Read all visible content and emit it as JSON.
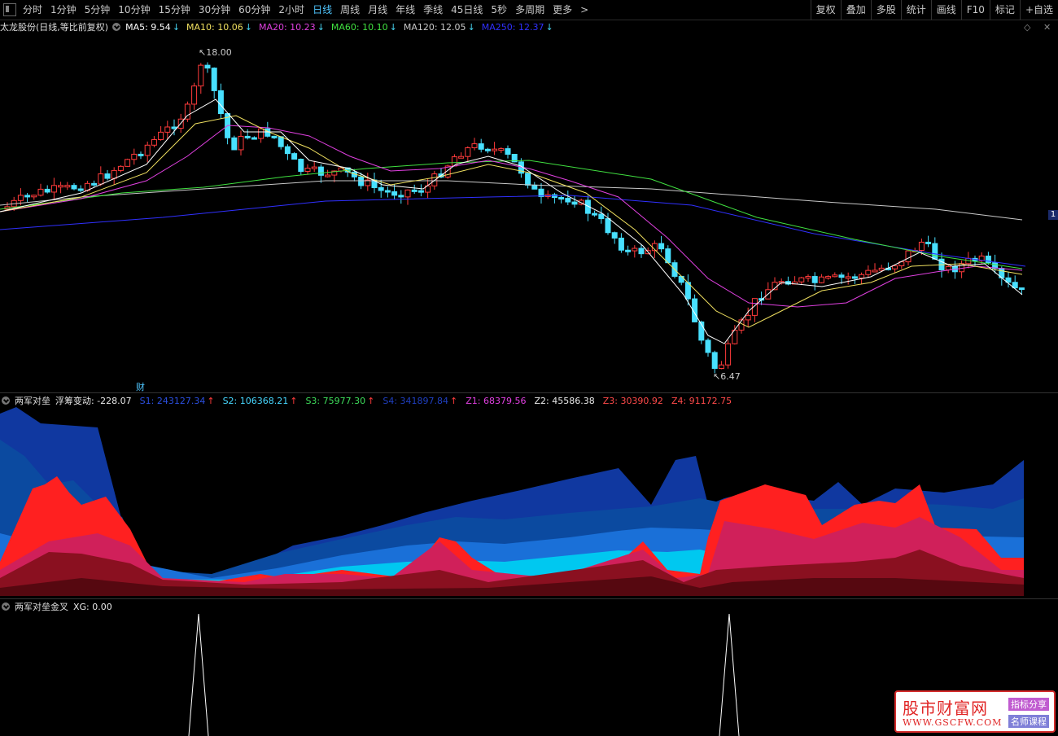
{
  "toolbar": {
    "periods": [
      "分时",
      "1分钟",
      "5分钟",
      "10分钟",
      "15分钟",
      "30分钟",
      "60分钟",
      "2小时",
      "日线",
      "周线",
      "月线",
      "年线",
      "季线",
      "45日线",
      "5秒",
      "多周期",
      "更多"
    ],
    "active_index": 8,
    "more_arrow": ">",
    "right": [
      "复权",
      "叠加",
      "多股",
      "统计",
      "画线",
      "F10",
      "标记",
      "+自选"
    ]
  },
  "main": {
    "title": "太龙股份(日线,等比前复权)",
    "mas": [
      {
        "label": "MA5: 9.54",
        "arrow": "↓",
        "color": "#ffffff"
      },
      {
        "label": "MA10: 10.06",
        "arrow": "↓",
        "color": "#f0e060"
      },
      {
        "label": "MA20: 10.23",
        "arrow": "↓",
        "color": "#e040e0"
      },
      {
        "label": "MA60: 10.10",
        "arrow": "↓",
        "color": "#40e040"
      },
      {
        "label": "MA120: 12.05",
        "arrow": "↓",
        "color": "#c8c8c8"
      },
      {
        "label": "MA250: 12.37",
        "arrow": "↓",
        "color": "#3030ff"
      }
    ],
    "high_label": "18.00",
    "low_label": "6.47",
    "cai": "财",
    "ctrl_icons": [
      "diamond-icon",
      "close-icon"
    ],
    "price_tag": "1"
  },
  "ind1": {
    "title": "两军对垒",
    "items": [
      {
        "label": "浮筹变动: -228.07",
        "color": "#e8e8e8",
        "arrow": ""
      },
      {
        "label": "S1: 243127.34",
        "color": "#2b4fe0",
        "arrow": "↑"
      },
      {
        "label": "S2: 106368.21",
        "color": "#47d7ff",
        "arrow": "↑"
      },
      {
        "label": "S3: 75977.30",
        "color": "#3ddc5a",
        "arrow": "↑"
      },
      {
        "label": "S4: 341897.84",
        "color": "#1f3fc0",
        "arrow": "↑"
      },
      {
        "label": "Z1: 68379.56",
        "color": "#e040e0",
        "arrow": ""
      },
      {
        "label": "Z2: 45586.38",
        "color": "#e8e8e8",
        "arrow": ""
      },
      {
        "label": "Z3: 30390.92",
        "color": "#ff4a4a",
        "arrow": ""
      },
      {
        "label": "Z4: 91172.75",
        "color": "#ff4a4a",
        "arrow": ""
      }
    ]
  },
  "ind2": {
    "title": "两军对垒金叉",
    "items": [
      {
        "label": "XG: 0.00",
        "color": "#e8e8e8"
      }
    ]
  },
  "logo": {
    "name": "股市财富网",
    "url": "WWW.GSCFW.COM",
    "tag1": "指标分享",
    "tag2": "名师课程"
  },
  "colors": {
    "up": "#ff3b3b",
    "down": "#48e0ff",
    "background": "#000000"
  }
}
